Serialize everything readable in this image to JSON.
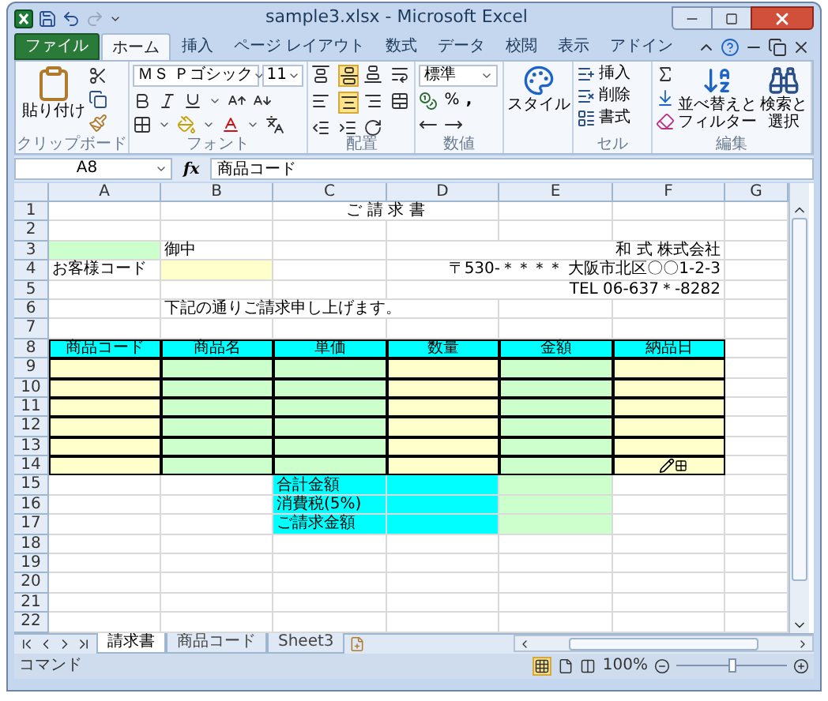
{
  "window": {
    "title": "sample3.xlsx - Microsoft Excel"
  },
  "ribbon_tabs": [
    {
      "label": "ファイル",
      "kind": "file",
      "selected": false
    },
    {
      "label": "ホーム",
      "kind": "tab",
      "selected": true
    },
    {
      "label": "挿入",
      "kind": "tab",
      "selected": false
    },
    {
      "label": "ページ レイアウト",
      "kind": "tab",
      "selected": false
    },
    {
      "label": "数式",
      "kind": "tab",
      "selected": false
    },
    {
      "label": "データ",
      "kind": "tab",
      "selected": false
    },
    {
      "label": "校閲",
      "kind": "tab",
      "selected": false
    },
    {
      "label": "表示",
      "kind": "tab",
      "selected": false
    },
    {
      "label": "アドイン",
      "kind": "tab",
      "selected": false
    }
  ],
  "ribbon": {
    "clipboard": {
      "paste": "貼り付け",
      "label": "クリップボード"
    },
    "font": {
      "name": "ＭＳ Ｐゴシック",
      "size": "11",
      "label": "フォント"
    },
    "alignment": {
      "label": "配置"
    },
    "number": {
      "format": "標準",
      "percent": "%",
      "comma": ",",
      "label": "数値"
    },
    "styles": {
      "button": "スタイル"
    },
    "cells": {
      "insert": "挿入",
      "delete": "削除",
      "format": "書式",
      "label": "セル"
    },
    "editing": {
      "sort": [
        "並べ替えと",
        "フィルター"
      ],
      "find": [
        "検索と",
        "選択"
      ],
      "label": "編集"
    }
  },
  "formula_bar": {
    "name_box": "A8",
    "function_label": "fx",
    "formula": "商品コード"
  },
  "sheet": {
    "columns": [
      "A",
      "B",
      "C",
      "D",
      "E",
      "F",
      "G"
    ],
    "rows": [
      {
        "label": "1",
        "cells": [
          {},
          {},
          {
            "kind": "title",
            "text": "ご 請 求 書"
          },
          {},
          {},
          {}
        ]
      },
      {
        "label": "2",
        "cells": [
          {},
          {},
          {},
          {},
          {},
          {},
          {}
        ]
      },
      {
        "label": "3",
        "cells": [
          {
            "color": "#ccffcc"
          },
          {
            "text": "御中"
          },
          {},
          {
            "kind": "address",
            "text": "和 式 株式会社"
          },
          {}
        ]
      },
      {
        "label": "4",
        "cells": [
          {
            "text": "お客様コード"
          },
          {
            "color": "#ffffcc"
          },
          {},
          {
            "kind": "address",
            "text": "〒530-＊＊＊＊  大阪市北区〇〇1-2-3"
          },
          {}
        ]
      },
      {
        "label": "5",
        "cells": [
          {},
          {},
          {},
          {
            "kind": "address",
            "text": "TEL  06-637＊-8282"
          },
          {}
        ]
      },
      {
        "label": "6",
        "cells": [
          {},
          {
            "kind": "note",
            "text": "下記の通りご請求申し上げます。"
          },
          {},
          {},
          {}
        ]
      },
      {
        "label": "7",
        "cells": [
          {},
          {},
          {},
          {},
          {},
          {},
          {}
        ]
      },
      {
        "label": "8",
        "cells": [
          {
            "kind": "heading",
            "text": "商品コード",
            "color": "#00ffff"
          },
          {
            "kind": "heading",
            "text": "商品名",
            "color": "#00ffff"
          },
          {
            "kind": "heading",
            "text": "単価",
            "color": "#00ffff"
          },
          {
            "kind": "heading",
            "text": "数量",
            "color": "#00ffff"
          },
          {
            "kind": "heading",
            "text": "金額",
            "color": "#00ffff"
          },
          {
            "kind": "heading",
            "text": "納品日",
            "color": "#00ffff"
          },
          {}
        ]
      },
      {
        "label": "9",
        "cells": [
          {
            "kind": "entry",
            "color": "#ffffcc"
          },
          {
            "kind": "entry",
            "color": "#ccffcc"
          },
          {
            "kind": "entry",
            "color": "#ccffcc"
          },
          {
            "kind": "entry",
            "color": "#ffffcc"
          },
          {
            "kind": "entry",
            "color": "#ccffcc"
          },
          {
            "kind": "entry",
            "color": "#ffffcc"
          },
          {}
        ]
      },
      {
        "label": "10",
        "cells": [
          {
            "kind": "entry",
            "color": "#ffffcc"
          },
          {
            "kind": "entry",
            "color": "#ccffcc"
          },
          {
            "kind": "entry",
            "color": "#ccffcc"
          },
          {
            "kind": "entry",
            "color": "#ffffcc"
          },
          {
            "kind": "entry",
            "color": "#ccffcc"
          },
          {
            "kind": "entry",
            "color": "#ffffcc"
          },
          {}
        ]
      },
      {
        "label": "11",
        "cells": [
          {
            "kind": "entry",
            "color": "#ffffcc"
          },
          {
            "kind": "entry",
            "color": "#ccffcc"
          },
          {
            "kind": "entry",
            "color": "#ccffcc"
          },
          {
            "kind": "entry",
            "color": "#ffffcc"
          },
          {
            "kind": "entry",
            "color": "#ccffcc"
          },
          {
            "kind": "entry",
            "color": "#ffffcc"
          },
          {}
        ]
      },
      {
        "label": "12",
        "cells": [
          {
            "kind": "entry",
            "color": "#ffffcc"
          },
          {
            "kind": "entry",
            "color": "#ccffcc"
          },
          {
            "kind": "entry",
            "color": "#ccffcc"
          },
          {
            "kind": "entry",
            "color": "#ffffcc"
          },
          {
            "kind": "entry",
            "color": "#ccffcc"
          },
          {
            "kind": "entry",
            "color": "#ffffcc"
          },
          {}
        ]
      },
      {
        "label": "13",
        "cells": [
          {
            "kind": "entry",
            "color": "#ffffcc"
          },
          {
            "kind": "entry",
            "color": "#ccffcc"
          },
          {
            "kind": "entry",
            "color": "#ccffcc"
          },
          {
            "kind": "entry",
            "color": "#ffffcc"
          },
          {
            "kind": "entry",
            "color": "#ccffcc"
          },
          {
            "kind": "entry",
            "color": "#ffffcc"
          },
          {}
        ]
      },
      {
        "label": "14",
        "cells": [
          {
            "kind": "entry",
            "color": "#ffffcc"
          },
          {
            "kind": "entry",
            "color": "#ccffcc"
          },
          {
            "kind": "entry",
            "color": "#ccffcc"
          },
          {
            "kind": "entry",
            "color": "#ffffcc"
          },
          {
            "kind": "entry",
            "color": "#ccffcc"
          },
          {
            "kind": "pointer",
            "color": "#ffffcc"
          },
          {}
        ]
      },
      {
        "label": "15",
        "cells": [
          {},
          {},
          {
            "text": "合計金額",
            "color": "#00ffff"
          },
          {
            "color": "#00ffff"
          },
          {
            "color": "#ccffcc"
          },
          {},
          {}
        ]
      },
      {
        "label": "16",
        "cells": [
          {},
          {},
          {
            "text": "消費税(5%)",
            "color": "#00ffff"
          },
          {
            "color": "#00ffff"
          },
          {
            "color": "#ccffcc"
          },
          {},
          {}
        ]
      },
      {
        "label": "17",
        "cells": [
          {},
          {},
          {
            "text": "ご請求金額",
            "color": "#00ffff"
          },
          {
            "color": "#00ffff"
          },
          {
            "color": "#ccffcc"
          },
          {},
          {}
        ]
      },
      {
        "label": "18",
        "cells": [
          {},
          {},
          {},
          {},
          {},
          {},
          {}
        ]
      },
      {
        "label": "19",
        "cells": [
          {},
          {},
          {},
          {},
          {},
          {},
          {}
        ]
      },
      {
        "label": "20",
        "cells": [
          {},
          {},
          {},
          {},
          {},
          {},
          {}
        ]
      },
      {
        "label": "21",
        "cells": [
          {},
          {},
          {},
          {},
          {},
          {},
          {}
        ]
      },
      {
        "label": "22",
        "cells": [
          {},
          {},
          {},
          {},
          {},
          {},
          {}
        ]
      }
    ]
  },
  "sheet_tabs": [
    {
      "label": "請求書",
      "selected": true
    },
    {
      "label": "商品コード",
      "selected": false
    },
    {
      "label": "Sheet3",
      "selected": false
    }
  ],
  "status_bar": {
    "mode": "コマンド",
    "zoom": "100%",
    "zoom_slider": {
      "level": 0.5
    }
  }
}
